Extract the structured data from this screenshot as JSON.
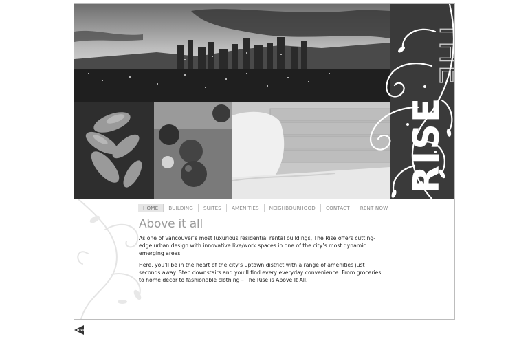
{
  "brand": {
    "name": "RISE",
    "article": "THE"
  },
  "nav": {
    "items": [
      {
        "label": "HOME",
        "active": true
      },
      {
        "label": "BUILDING"
      },
      {
        "label": "SUITES"
      },
      {
        "label": "AMENITIES"
      },
      {
        "label": "NEIGHBOURHOOD"
      },
      {
        "label": "CONTACT"
      },
      {
        "label": "RENT NOW"
      }
    ]
  },
  "content": {
    "title": "Above it all",
    "paragraph1": "As one of Vancouver’s most luxurious residential rental buildings, The Rise offers cutting-edge urban design with innovative live/work spaces in one of the city’s most dynamic emerging areas.",
    "paragraph2": "Here, you’ll be in the heart of the city’s uptown district with a range of amenities just seconds away. Step downstairs and you’ll find every everyday convenience. From groceries to home décor to fashionable clothing – The Rise is Above It All."
  },
  "music": {
    "label": "music"
  }
}
